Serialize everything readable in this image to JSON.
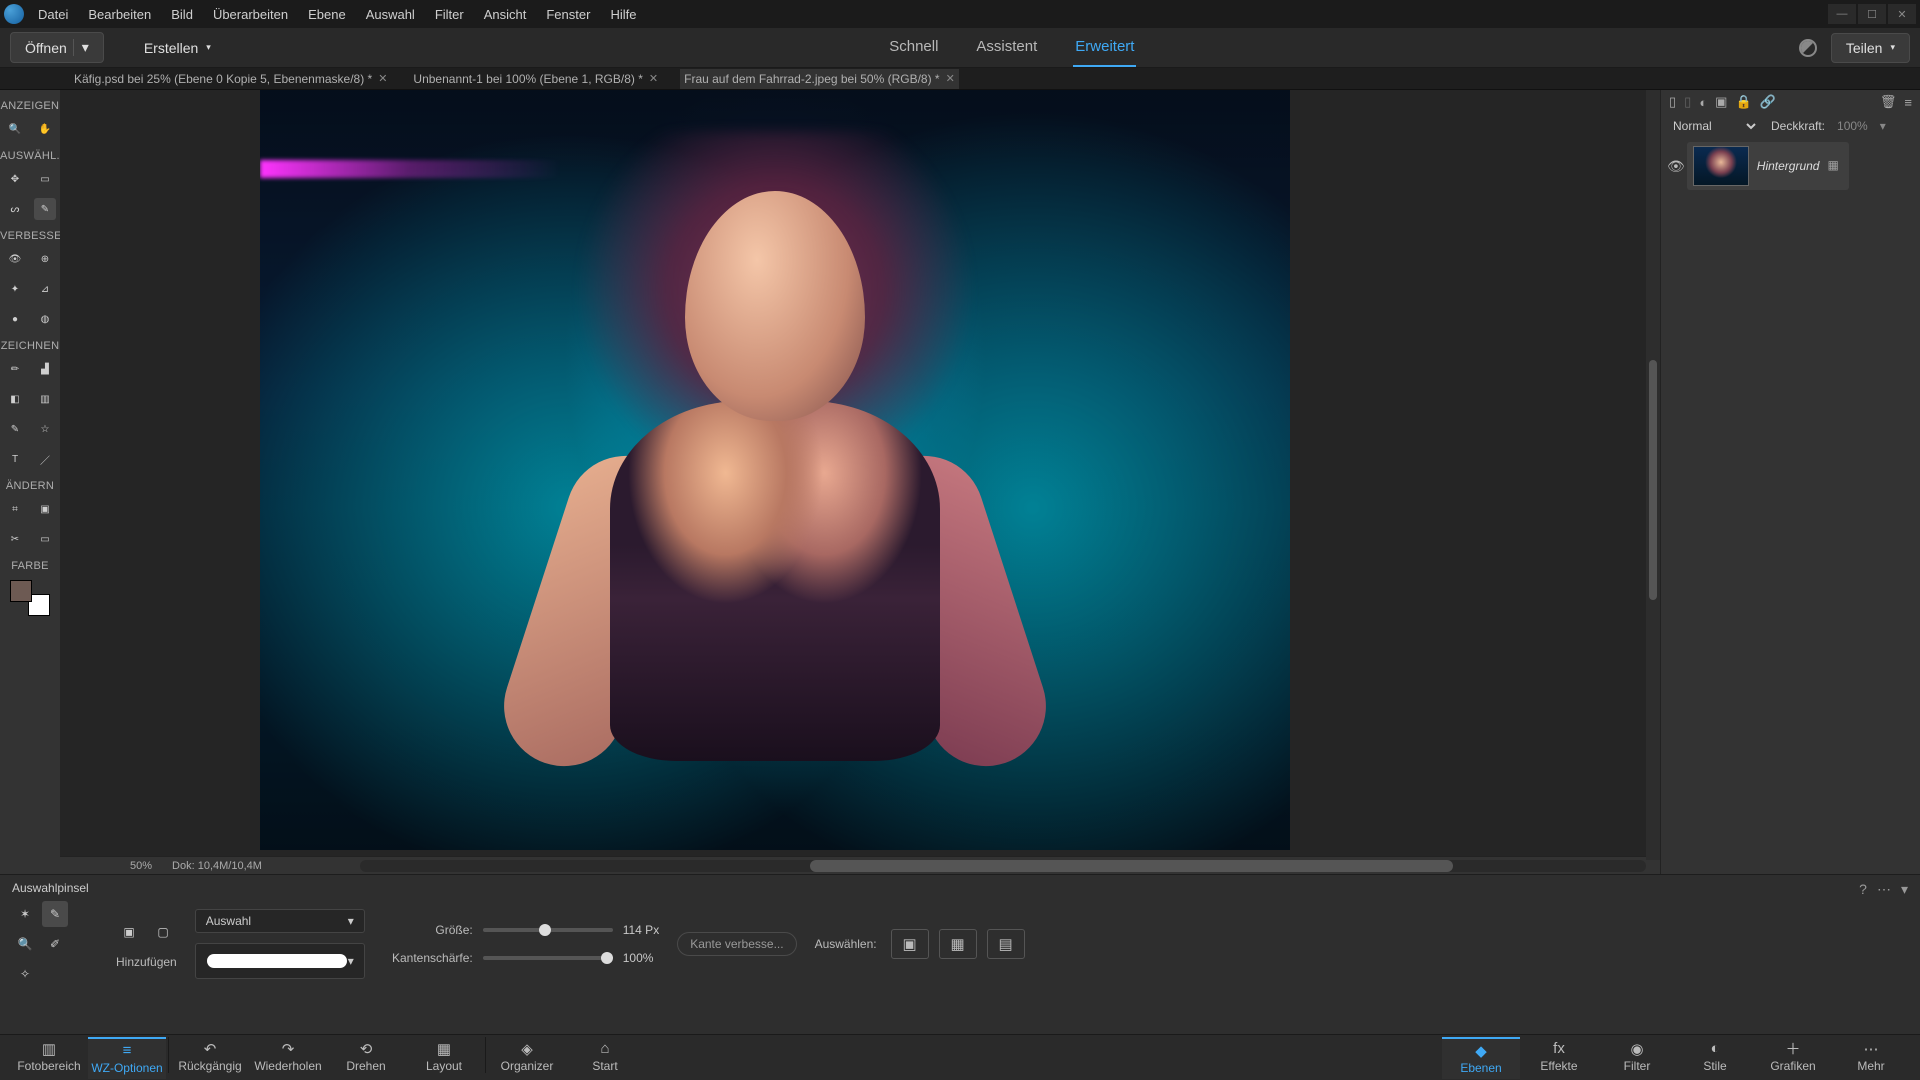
{
  "menu": [
    "Datei",
    "Bearbeiten",
    "Bild",
    "Überarbeiten",
    "Ebene",
    "Auswahl",
    "Filter",
    "Ansicht",
    "Fenster",
    "Hilfe"
  ],
  "optionsbar": {
    "open": "Öffnen",
    "create": "Erstellen",
    "modes": {
      "quick": "Schnell",
      "guided": "Assistent",
      "expert": "Erweitert"
    },
    "share": "Teilen"
  },
  "tabs": [
    {
      "label": "Käfig.psd bei 25% (Ebene 0 Kopie 5, Ebenenmaske/8) *",
      "active": false
    },
    {
      "label": "Unbenannt-1 bei 100% (Ebene 1, RGB/8) *",
      "active": false
    },
    {
      "label": "Frau auf dem Fahrrad-2.jpeg bei 50% (RGB/8) *",
      "active": true
    }
  ],
  "tools": {
    "sections": {
      "view": "ANZEIGEN",
      "select": "AUSWÄHL...",
      "enhance": "VERBESSE...",
      "draw": "ZEICHNEN",
      "modify": "ÄNDERN",
      "color": "FARBE"
    }
  },
  "layerspanel": {
    "blendmode": "Normal",
    "opacity_label": "Deckkraft:",
    "opacity_value": "100%",
    "layers": [
      {
        "name": "Hintergrund"
      }
    ]
  },
  "status": {
    "zoom": "50%",
    "docsize": "Dok: 10,4M/10,4M"
  },
  "tooloptions": {
    "name": "Auswahlpinsel",
    "mode": "Hinzufügen",
    "dropdown": "Auswahl",
    "size_label": "Größe:",
    "size_value": "114 Px",
    "hardness_label": "Kantenschärfe:",
    "hardness_value": "100%",
    "refine": "Kante verbesse...",
    "select_label": "Auswählen:"
  },
  "bottombar": {
    "left": [
      {
        "id": "fotobereich",
        "label": "Fotobereich",
        "icon": "▥"
      },
      {
        "id": "wzoptionen",
        "label": "WZ-Optionen",
        "icon": "≡"
      },
      {
        "id": "rueckgaengig",
        "label": "Rückgängig",
        "icon": "↶"
      },
      {
        "id": "wiederholen",
        "label": "Wiederholen",
        "icon": "↷"
      },
      {
        "id": "drehen",
        "label": "Drehen",
        "icon": "⟲"
      },
      {
        "id": "layout",
        "label": "Layout",
        "icon": "▦"
      },
      {
        "id": "organizer",
        "label": "Organizer",
        "icon": "◈"
      },
      {
        "id": "start",
        "label": "Start",
        "icon": "⌂"
      }
    ],
    "right": [
      {
        "id": "ebenen",
        "label": "Ebenen",
        "icon": "◆"
      },
      {
        "id": "effekte",
        "label": "Effekte",
        "icon": "fx"
      },
      {
        "id": "filter",
        "label": "Filter",
        "icon": "◉"
      },
      {
        "id": "stile",
        "label": "Stile",
        "icon": "◐"
      },
      {
        "id": "grafiken",
        "label": "Grafiken",
        "icon": "＋"
      },
      {
        "id": "mehr",
        "label": "Mehr",
        "icon": "⋯"
      }
    ],
    "active_left": "wzoptionen",
    "active_right": "ebenen"
  }
}
